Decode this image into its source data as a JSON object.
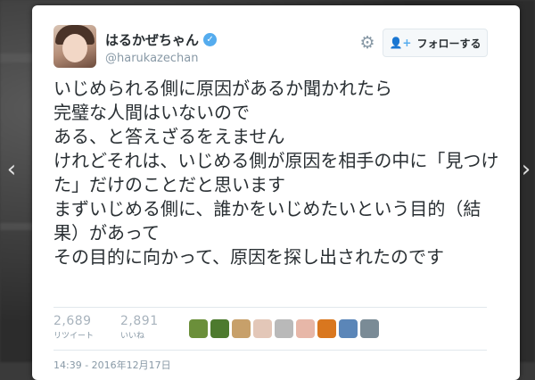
{
  "user": {
    "display_name": "はるかぜちゃん",
    "handle": "@harukazechan",
    "verified_icon": "verified-badge"
  },
  "actions": {
    "settings_icon": "gear-icon",
    "follow_label": "フォローする",
    "follow_icon": "person-add-icon"
  },
  "tweet": {
    "text": "いじめられる側に原因があるか聞かれたら\n完璧な人間はいないので\nある、と答えざるをえません\nけれどそれは、いじめる側が原因を相手の中に「見つけた」だけのことだと思います\nまずいじめる側に、誰かをいじめたいという目的（結果）があって\nその目的に向かって、原因を探し出されたのです",
    "timestamp": "14:39 - 2016年12月17日"
  },
  "stats": [
    {
      "count": "2,689",
      "label": "リツイート"
    },
    {
      "count": "2,891",
      "label": "いいね"
    }
  ],
  "likers": [
    {
      "color": "#6b8f3a"
    },
    {
      "color": "#4d7a2e"
    },
    {
      "color": "#c7a06a"
    },
    {
      "color": "#e3c7b8"
    },
    {
      "color": "#b9b9b9"
    },
    {
      "color": "#e7b7a8"
    },
    {
      "color": "#d9771f"
    },
    {
      "color": "#5b86b8"
    },
    {
      "color": "#7a8b96"
    }
  ],
  "colors": {
    "accent": "#55acee",
    "text": "#292f33",
    "muted": "#8899a6"
  }
}
